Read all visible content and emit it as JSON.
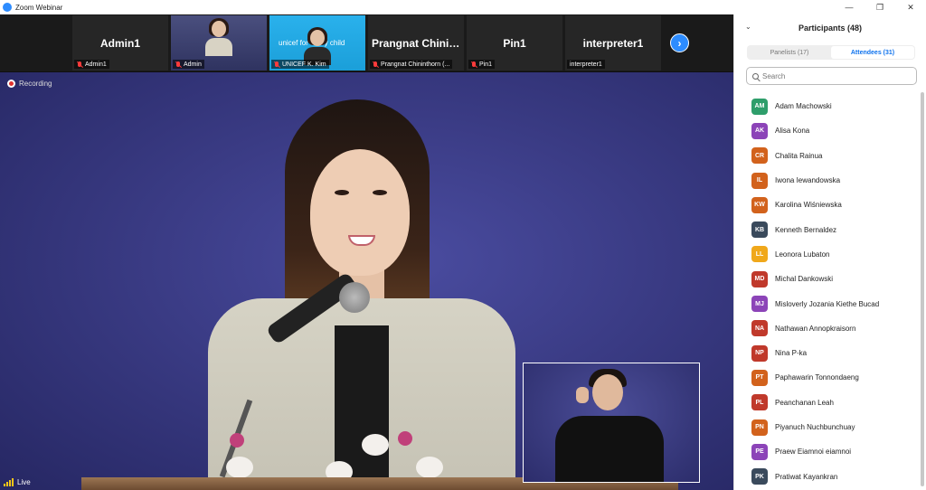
{
  "window": {
    "title": "Zoom Webinar",
    "controls": [
      "—",
      "❐",
      "✕"
    ]
  },
  "strip": {
    "tiles": [
      {
        "big_name": "Admin1",
        "label": "Admin1",
        "muted": true,
        "kind": "name"
      },
      {
        "big_name": "",
        "label": "Admin",
        "muted": true,
        "kind": "video-a"
      },
      {
        "big_name": "",
        "label": "UNICEF K. Kim",
        "muted": true,
        "kind": "video-b",
        "sign_text": "unicef for every child"
      },
      {
        "big_name": "Prangnat Chinin...",
        "label": "Prangnat Chininthorn (...",
        "muted": true,
        "kind": "name"
      },
      {
        "big_name": "Pin1",
        "label": "Pin1",
        "muted": true,
        "kind": "name"
      },
      {
        "big_name": "interpreter1",
        "label": "interpreter1",
        "muted": false,
        "kind": "name"
      }
    ],
    "next_icon": "›"
  },
  "stage": {
    "recording_label": "Recording",
    "live_label": "Live"
  },
  "participants": {
    "title": "Participants (48)",
    "tabs": {
      "panelists": "Panelists (17)",
      "attendees": "Attendees (31)",
      "active": "attendees"
    },
    "search_placeholder": "Search",
    "list": [
      {
        "initials": "AM",
        "name": "Adam Machowski",
        "color": "#2e9e6b"
      },
      {
        "initials": "AK",
        "name": "Alisa Kona",
        "color": "#8c44b8"
      },
      {
        "initials": "CR",
        "name": "Chalita Rainua",
        "color": "#d2621c"
      },
      {
        "initials": "IL",
        "name": "Iwona Iewandowska",
        "color": "#d2621c"
      },
      {
        "initials": "KW",
        "name": "Karolina Wiśniewska",
        "color": "#d2621c"
      },
      {
        "initials": "KB",
        "name": "Kenneth Bernaldez",
        "color": "#3a4a5c"
      },
      {
        "initials": "LL",
        "name": "Leonora Lubaton",
        "color": "#f0a81b"
      },
      {
        "initials": "MD",
        "name": "Michal Dankowski",
        "color": "#c0392b"
      },
      {
        "initials": "MJ",
        "name": "Misloverly Jozania Kiethe Bucad",
        "color": "#8c44b8"
      },
      {
        "initials": "NA",
        "name": "Nathawan Annopkraisorn",
        "color": "#c0392b"
      },
      {
        "initials": "NP",
        "name": "Nina P-ka",
        "color": "#c0392b"
      },
      {
        "initials": "PT",
        "name": "Paphawarin Tonnondaeng",
        "color": "#d2621c"
      },
      {
        "initials": "PL",
        "name": "Peanchanan Leah",
        "color": "#c0392b"
      },
      {
        "initials": "PN",
        "name": "Piyanuch Nuchbunchuay",
        "color": "#d2621c"
      },
      {
        "initials": "PE",
        "name": "Praew Eiamnoi eiamnoi",
        "color": "#8c44b8"
      },
      {
        "initials": "PK",
        "name": "Pratiwat Kayankran",
        "color": "#3a4a5c"
      }
    ]
  }
}
